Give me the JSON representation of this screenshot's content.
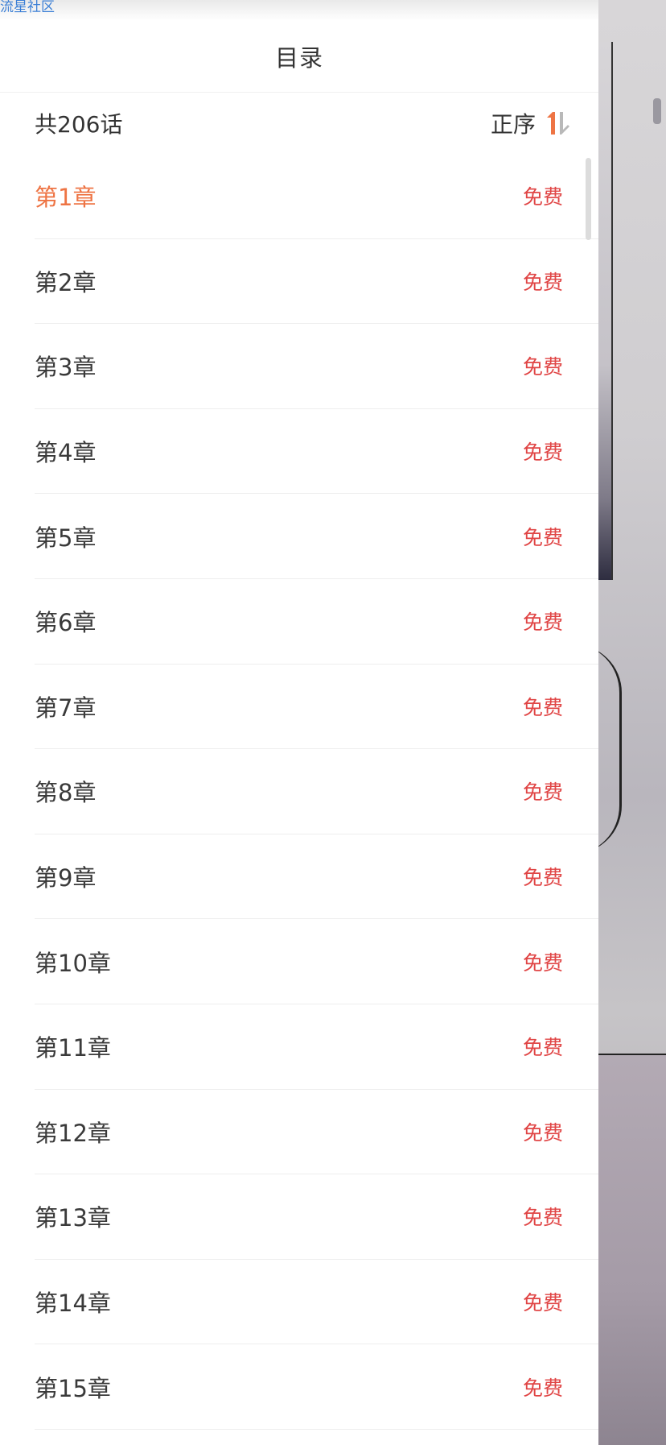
{
  "watermark": "流星社区",
  "title": "目录",
  "summary": {
    "count_label": "共206话",
    "sort_label": "正序",
    "sort_icon": "sort-order-icon"
  },
  "colors": {
    "current_chapter": "#ee7444",
    "price": "#e04545",
    "sort_up": "#ee7444",
    "sort_down": "#b9b9b9"
  },
  "chapters": [
    {
      "label": "第1章",
      "price": "免费",
      "current": true
    },
    {
      "label": "第2章",
      "price": "免费"
    },
    {
      "label": "第3章",
      "price": "免费"
    },
    {
      "label": "第4章",
      "price": "免费"
    },
    {
      "label": "第5章",
      "price": "免费"
    },
    {
      "label": "第6章",
      "price": "免费"
    },
    {
      "label": "第7章",
      "price": "免费"
    },
    {
      "label": "第8章",
      "price": "免费"
    },
    {
      "label": "第9章",
      "price": "免费"
    },
    {
      "label": "第10章",
      "price": "免费"
    },
    {
      "label": "第11章",
      "price": "免费"
    },
    {
      "label": "第12章",
      "price": "免费"
    },
    {
      "label": "第13章",
      "price": "免费"
    },
    {
      "label": "第14章",
      "price": "免费"
    },
    {
      "label": "第15章",
      "price": "免费"
    }
  ]
}
